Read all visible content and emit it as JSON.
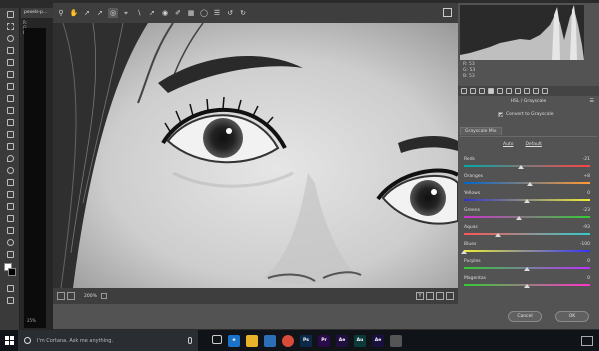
{
  "photoshop": {
    "doc_tab": "pexels-p...",
    "info_r_label": "R:",
    "info_g_label": "G:",
    "info_b_label": "B:",
    "zoom": "25%"
  },
  "camera_raw": {
    "toolbar_icons": [
      "zoom-icon",
      "hand-icon",
      "white-balance-icon",
      "color-sampler-icon",
      "targeted-adjustment-icon",
      "crop-icon",
      "straighten-icon",
      "spot-removal-icon",
      "red-eye-icon",
      "adjustment-brush-icon",
      "graduated-filter-icon",
      "radial-filter-icon",
      "preferences-icon",
      "rotate-ccw-icon",
      "rotate-cw-icon"
    ],
    "zoom_value": "200%",
    "rgb": {
      "r_label": "R:",
      "r_value": "53",
      "g_label": "G:",
      "g_value": "53",
      "b_label": "B:",
      "b_value": "53"
    },
    "panel_title": "HSL / Grayscale",
    "convert_label": "Convert to Grayscale",
    "tab_label": "Grayscale Mix",
    "auto_label": "Auto",
    "default_label": "Default",
    "sliders": [
      {
        "label": "Reds",
        "value": "-21",
        "fraction": 0.45
      },
      {
        "label": "Oranges",
        "value": "+8",
        "fraction": 0.52
      },
      {
        "label": "Yellows",
        "value": "0",
        "fraction": 0.5
      },
      {
        "label": "Greens",
        "value": "-23",
        "fraction": 0.44
      },
      {
        "label": "Aquas",
        "value": "-93",
        "fraction": 0.27
      },
      {
        "label": "Blues",
        "value": "-100",
        "fraction": 0.0
      },
      {
        "label": "Purples",
        "value": "0",
        "fraction": 0.5
      },
      {
        "label": "Magentas",
        "value": "0",
        "fraction": 0.5
      }
    ],
    "cancel_label": "Cancel",
    "ok_label": "OK"
  },
  "taskbar": {
    "search_placeholder": "I'm Cortana. Ask me anything.",
    "apps": [
      {
        "name": "task-view-icon",
        "label": "",
        "color": "#101418"
      },
      {
        "name": "edge-icon",
        "label": "e",
        "color": "#1a73c9"
      },
      {
        "name": "file-explorer-icon",
        "label": "",
        "color": "#e8b32a"
      },
      {
        "name": "store-icon",
        "label": "",
        "color": "#2d6fb7"
      },
      {
        "name": "chrome-icon",
        "label": "",
        "color": "#d94b3b"
      },
      {
        "name": "photoshop-icon",
        "label": "Ps",
        "color": "#0b2a4a"
      },
      {
        "name": "premiere-icon",
        "label": "Pr",
        "color": "#2a0b4a"
      },
      {
        "name": "after-effects-icon",
        "label": "Ae",
        "color": "#1f1040"
      },
      {
        "name": "audition-icon",
        "label": "Au",
        "color": "#0b3a3a"
      },
      {
        "name": "media-encoder-icon",
        "label": "Ae",
        "color": "#1a1040"
      },
      {
        "name": "misc-app-icon",
        "label": "",
        "color": "#555555"
      }
    ]
  },
  "colors": {
    "accent": "#1a73c9",
    "dialog_bg": "#535353",
    "toolbar_bg": "#3e3e3e"
  }
}
